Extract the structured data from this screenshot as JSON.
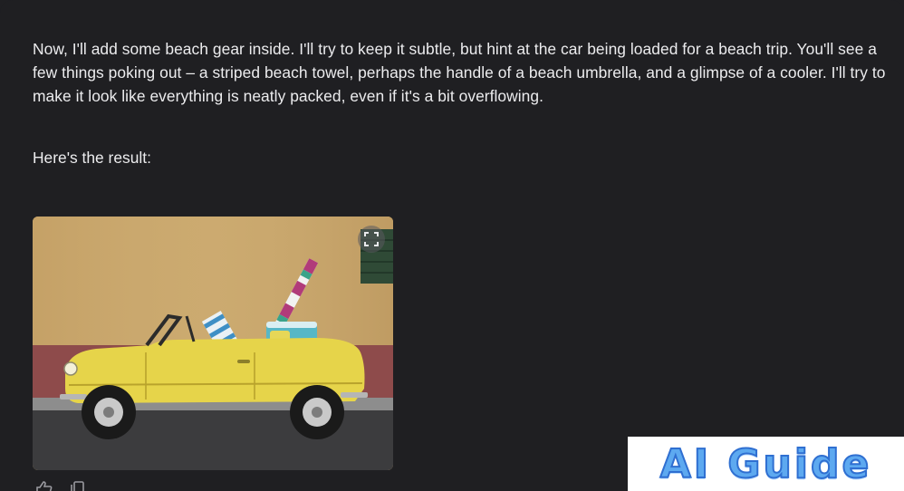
{
  "conversation": {
    "intro_paragraph": "Now, I'll add some beach gear inside. I'll try to keep it subtle, but hint at the car being loaded for a beach trip. You'll see a few things poking out – a striped beach towel, perhaps the handle of a beach umbrella, and a glimpse of a cooler. I'll try to make it look like everything is neatly packed, even if it's a bit overflowing.",
    "result_intro": "Here's the result:"
  },
  "image": {
    "expand_icon": "expand-icon"
  },
  "actions": {
    "icons": [
      "thumbs-up-icon",
      "copy-icon"
    ]
  },
  "watermark": {
    "text": "AI Guide"
  },
  "colors": {
    "background": "#1f1f22",
    "text": "#ececee",
    "car_yellow": "#e6d44a",
    "wall": "#c9a76d",
    "watermark_blue": "#5da9f0"
  }
}
